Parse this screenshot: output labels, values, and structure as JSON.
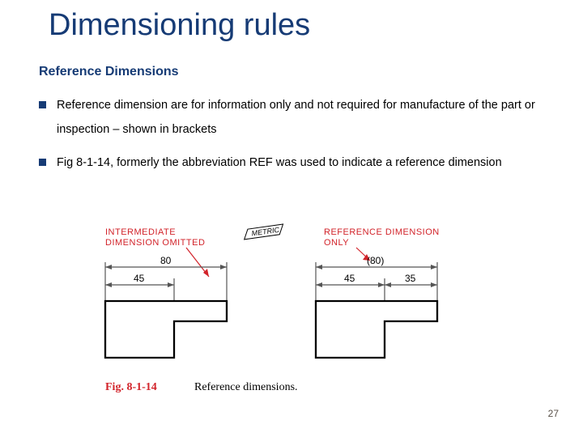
{
  "title": "Dimensioning rules",
  "subtitle": "Reference Dimensions",
  "bullets": [
    "Reference dimension are for information only and not required for manufacture of the part or inspection – shown in brackets",
    "Fig 8-1-14, formerly the abbreviation REF was used to indicate a reference dimension"
  ],
  "page_number": "27",
  "figure": {
    "left_label_line1": "INTERMEDIATE",
    "left_label_line2": "DIMENSION OMITTED",
    "right_label_line1": "REFERENCE DIMENSION",
    "right_label_line2": "ONLY",
    "metric_badge": "METRIC",
    "left_dims": {
      "top": "80",
      "lower": "45"
    },
    "right_dims": {
      "top": "(80)",
      "lower_left": "45",
      "lower_right": "35"
    },
    "caption_ref": "Fig. 8-1-14",
    "caption_text": "Reference dimensions."
  }
}
